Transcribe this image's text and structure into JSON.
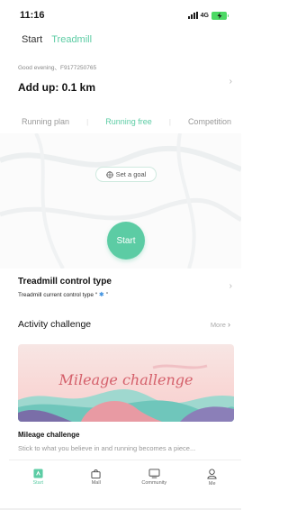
{
  "status_bar": {
    "time": "11:16",
    "network": "4G"
  },
  "top_tabs": [
    {
      "label": "Start",
      "active": false
    },
    {
      "label": "Treadmill",
      "active": true
    }
  ],
  "header": {
    "greeting": "Good evening、F9177250765",
    "add_up": "Add up: 0.1 km"
  },
  "sub_tabs": [
    {
      "label": "Running plan",
      "active": false
    },
    {
      "label": "Running free",
      "active": true
    },
    {
      "label": "Competition",
      "active": false
    }
  ],
  "run_area": {
    "set_goal_label": "Set a goal",
    "start_label": "Start"
  },
  "treadmill": {
    "title": "Treadmill control type",
    "subtitle_prefix": "Treadmill current control type “",
    "subtitle_suffix": "”"
  },
  "activity": {
    "title": "Activity challenge",
    "more_label": "More"
  },
  "banner": {
    "text": "Mileage challenge"
  },
  "mileage_challenge": {
    "title": "Mileage challenge",
    "description": "Stick to what you believe in and running becomes a piece..."
  },
  "bottom_nav": [
    {
      "label": "Start",
      "icon": "start-icon",
      "active": true
    },
    {
      "label": "Mall",
      "icon": "bag-icon",
      "active": false
    },
    {
      "label": "Community",
      "icon": "monitor-icon",
      "active": false
    },
    {
      "label": "Me",
      "icon": "person-icon",
      "active": false
    }
  ],
  "colors": {
    "accent": "#5ccca4",
    "banner_text": "#d45f6a",
    "battery": "#4cd964"
  }
}
